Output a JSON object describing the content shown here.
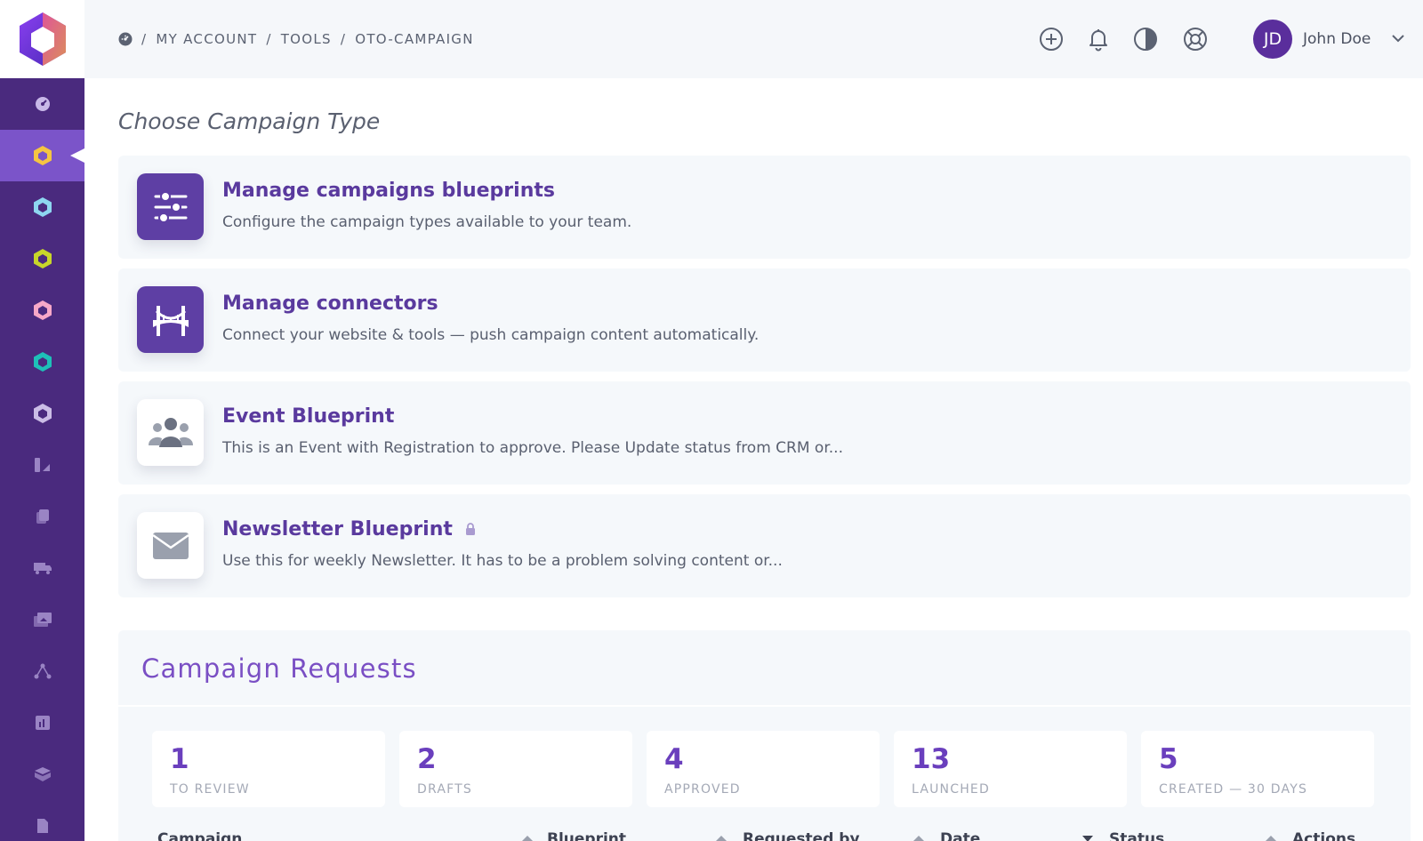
{
  "breadcrumb": {
    "items": [
      "MY ACCOUNT",
      "TOOLS",
      "OTO-CAMPAIGN"
    ],
    "separator": "/"
  },
  "header": {
    "icons": [
      "add-circle-icon",
      "bell-icon",
      "contrast-icon",
      "lifebuoy-icon"
    ],
    "user": {
      "initials": "JD",
      "name": "John Doe"
    }
  },
  "sidebar": {
    "items": [
      {
        "icon": "dashboard-icon",
        "color": "#c8b8e8"
      },
      {
        "icon": "hexagon-icon",
        "color": "#f5c542",
        "active": true
      },
      {
        "icon": "hexagon-icon",
        "color": "#8ed6f0"
      },
      {
        "icon": "hexagon-icon",
        "color": "#c8d62a"
      },
      {
        "icon": "hexagon-icon",
        "color": "#f7a8c8"
      },
      {
        "icon": "hexagon-icon",
        "color": "#1ec0b8"
      },
      {
        "icon": "hexagon-icon",
        "color": "#cbbde6"
      },
      {
        "icon": "tools-icon",
        "color": "#9a84c4"
      },
      {
        "icon": "documents-icon",
        "color": "#9a84c4"
      },
      {
        "icon": "truck-icon",
        "color": "#9a84c4"
      },
      {
        "icon": "images-icon",
        "color": "#9a84c4"
      },
      {
        "icon": "network-icon",
        "color": "#9a84c4"
      },
      {
        "icon": "chart-icon",
        "color": "#9a84c4"
      },
      {
        "icon": "box-icon",
        "color": "#9a84c4"
      },
      {
        "icon": "file-icon",
        "color": "#9a84c4"
      }
    ]
  },
  "main": {
    "section_title": "Choose Campaign Type",
    "cards": [
      {
        "title": "Manage campaigns blueprints",
        "description": "Configure the campaign types available to your team.",
        "icon": "sliders-icon"
      },
      {
        "title": "Manage connectors",
        "description": "Connect your website & tools — push campaign content automatically.",
        "icon": "bridge-icon"
      },
      {
        "title": "Event Blueprint",
        "description": "This is an Event with Registration to approve. Please Update status from CRM or...",
        "icon": "users-icon"
      },
      {
        "title": "Newsletter Blueprint",
        "description": "Use this for weekly Newsletter. It has to be a problem solving content or...",
        "icon": "envelope-icon",
        "locked": true
      }
    ]
  },
  "requests": {
    "title": "Campaign Requests",
    "stats": [
      {
        "value": "1",
        "label": "TO REVIEW"
      },
      {
        "value": "2",
        "label": "DRAFTS"
      },
      {
        "value": "4",
        "label": "APPROVED"
      },
      {
        "value": "13",
        "label": "LAUNCHED"
      },
      {
        "value": "5",
        "label": "CREATED — 30 DAYS"
      }
    ],
    "columns": [
      "Campaign",
      "Blueprint",
      "Requested by",
      "Date",
      "Status",
      "Actions"
    ]
  },
  "colors": {
    "sidebar": "#4a2a7e",
    "sidebar_active": "#7b54c9",
    "accent": "#5a3a9e",
    "avatar": "#5a2e9c"
  }
}
